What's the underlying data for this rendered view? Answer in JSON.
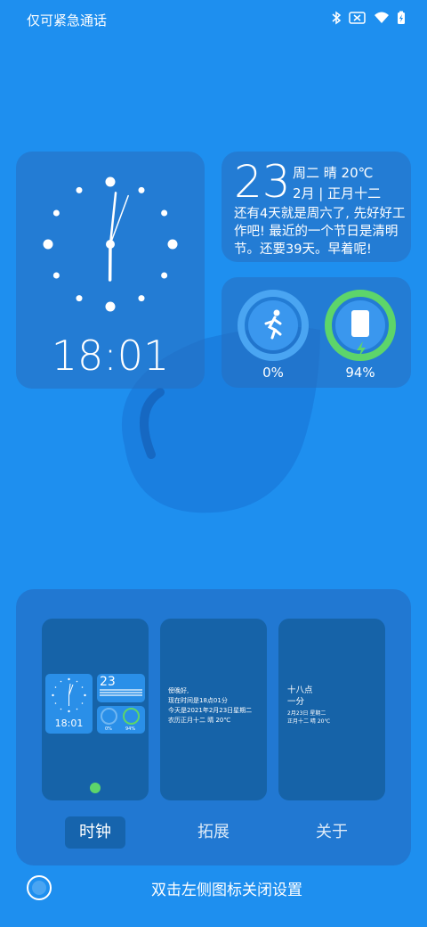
{
  "status_bar": {
    "text": "仅可紧急通话",
    "icons": [
      "bluetooth-icon",
      "no-sim-icon",
      "wifi-icon",
      "battery-charging-icon"
    ]
  },
  "clock_widget": {
    "time": "18:01",
    "hour_hand": "18",
    "minute_hand": "01"
  },
  "date_widget": {
    "day": "23",
    "line1": "周二 晴 20℃",
    "line2": "2月 | 正月十二",
    "message": "还有4天就是周六了, 先好好工作吧! 最近的一个节日是清明节。还要39天。早着呢!"
  },
  "stats_widget": {
    "steps_percent": "0%",
    "battery_percent": "94%",
    "battery_level": 0.94,
    "steps_level": 0.0,
    "colors": {
      "steps_ring": "#7cc0f5",
      "battery_ring": "#5dd56a"
    }
  },
  "settings": {
    "preview_clock": {
      "time": "18:01",
      "day": "23",
      "steps": "0%",
      "battery": "94%"
    },
    "preview_extend": {
      "lines": [
        "傍晚好,",
        "现在时间是18点01分",
        "今天是2021年2月23日星期二",
        "农历正月十二 晴 20℃"
      ]
    },
    "preview_about": {
      "big_lines": [
        "十八点",
        "一分"
      ],
      "small_lines": [
        "2月23日 星期二",
        "正月十二 晴 20℃"
      ]
    },
    "tabs": [
      "时钟",
      "拓展",
      "关于"
    ],
    "active_tab": 0
  },
  "footer": {
    "hint": "双击左侧图标关闭设置"
  }
}
